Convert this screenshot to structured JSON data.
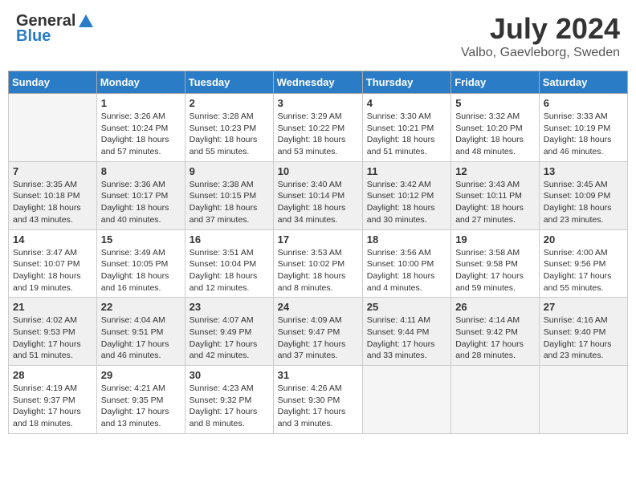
{
  "header": {
    "logo_general": "General",
    "logo_blue": "Blue",
    "month_year": "July 2024",
    "location": "Valbo, Gaevleborg, Sweden"
  },
  "days_of_week": [
    "Sunday",
    "Monday",
    "Tuesday",
    "Wednesday",
    "Thursday",
    "Friday",
    "Saturday"
  ],
  "weeks": [
    [
      {
        "day": "",
        "sunrise": "",
        "sunset": "",
        "daylight": "",
        "empty": true
      },
      {
        "day": "1",
        "sunrise": "Sunrise: 3:26 AM",
        "sunset": "Sunset: 10:24 PM",
        "daylight": "Daylight: 18 hours and 57 minutes."
      },
      {
        "day": "2",
        "sunrise": "Sunrise: 3:28 AM",
        "sunset": "Sunset: 10:23 PM",
        "daylight": "Daylight: 18 hours and 55 minutes."
      },
      {
        "day": "3",
        "sunrise": "Sunrise: 3:29 AM",
        "sunset": "Sunset: 10:22 PM",
        "daylight": "Daylight: 18 hours and 53 minutes."
      },
      {
        "day": "4",
        "sunrise": "Sunrise: 3:30 AM",
        "sunset": "Sunset: 10:21 PM",
        "daylight": "Daylight: 18 hours and 51 minutes."
      },
      {
        "day": "5",
        "sunrise": "Sunrise: 3:32 AM",
        "sunset": "Sunset: 10:20 PM",
        "daylight": "Daylight: 18 hours and 48 minutes."
      },
      {
        "day": "6",
        "sunrise": "Sunrise: 3:33 AM",
        "sunset": "Sunset: 10:19 PM",
        "daylight": "Daylight: 18 hours and 46 minutes."
      }
    ],
    [
      {
        "day": "7",
        "sunrise": "Sunrise: 3:35 AM",
        "sunset": "Sunset: 10:18 PM",
        "daylight": "Daylight: 18 hours and 43 minutes."
      },
      {
        "day": "8",
        "sunrise": "Sunrise: 3:36 AM",
        "sunset": "Sunset: 10:17 PM",
        "daylight": "Daylight: 18 hours and 40 minutes."
      },
      {
        "day": "9",
        "sunrise": "Sunrise: 3:38 AM",
        "sunset": "Sunset: 10:15 PM",
        "daylight": "Daylight: 18 hours and 37 minutes."
      },
      {
        "day": "10",
        "sunrise": "Sunrise: 3:40 AM",
        "sunset": "Sunset: 10:14 PM",
        "daylight": "Daylight: 18 hours and 34 minutes."
      },
      {
        "day": "11",
        "sunrise": "Sunrise: 3:42 AM",
        "sunset": "Sunset: 10:12 PM",
        "daylight": "Daylight: 18 hours and 30 minutes."
      },
      {
        "day": "12",
        "sunrise": "Sunrise: 3:43 AM",
        "sunset": "Sunset: 10:11 PM",
        "daylight": "Daylight: 18 hours and 27 minutes."
      },
      {
        "day": "13",
        "sunrise": "Sunrise: 3:45 AM",
        "sunset": "Sunset: 10:09 PM",
        "daylight": "Daylight: 18 hours and 23 minutes."
      }
    ],
    [
      {
        "day": "14",
        "sunrise": "Sunrise: 3:47 AM",
        "sunset": "Sunset: 10:07 PM",
        "daylight": "Daylight: 18 hours and 19 minutes."
      },
      {
        "day": "15",
        "sunrise": "Sunrise: 3:49 AM",
        "sunset": "Sunset: 10:05 PM",
        "daylight": "Daylight: 18 hours and 16 minutes."
      },
      {
        "day": "16",
        "sunrise": "Sunrise: 3:51 AM",
        "sunset": "Sunset: 10:04 PM",
        "daylight": "Daylight: 18 hours and 12 minutes."
      },
      {
        "day": "17",
        "sunrise": "Sunrise: 3:53 AM",
        "sunset": "Sunset: 10:02 PM",
        "daylight": "Daylight: 18 hours and 8 minutes."
      },
      {
        "day": "18",
        "sunrise": "Sunrise: 3:56 AM",
        "sunset": "Sunset: 10:00 PM",
        "daylight": "Daylight: 18 hours and 4 minutes."
      },
      {
        "day": "19",
        "sunrise": "Sunrise: 3:58 AM",
        "sunset": "Sunset: 9:58 PM",
        "daylight": "Daylight: 17 hours and 59 minutes."
      },
      {
        "day": "20",
        "sunrise": "Sunrise: 4:00 AM",
        "sunset": "Sunset: 9:56 PM",
        "daylight": "Daylight: 17 hours and 55 minutes."
      }
    ],
    [
      {
        "day": "21",
        "sunrise": "Sunrise: 4:02 AM",
        "sunset": "Sunset: 9:53 PM",
        "daylight": "Daylight: 17 hours and 51 minutes."
      },
      {
        "day": "22",
        "sunrise": "Sunrise: 4:04 AM",
        "sunset": "Sunset: 9:51 PM",
        "daylight": "Daylight: 17 hours and 46 minutes."
      },
      {
        "day": "23",
        "sunrise": "Sunrise: 4:07 AM",
        "sunset": "Sunset: 9:49 PM",
        "daylight": "Daylight: 17 hours and 42 minutes."
      },
      {
        "day": "24",
        "sunrise": "Sunrise: 4:09 AM",
        "sunset": "Sunset: 9:47 PM",
        "daylight": "Daylight: 17 hours and 37 minutes."
      },
      {
        "day": "25",
        "sunrise": "Sunrise: 4:11 AM",
        "sunset": "Sunset: 9:44 PM",
        "daylight": "Daylight: 17 hours and 33 minutes."
      },
      {
        "day": "26",
        "sunrise": "Sunrise: 4:14 AM",
        "sunset": "Sunset: 9:42 PM",
        "daylight": "Daylight: 17 hours and 28 minutes."
      },
      {
        "day": "27",
        "sunrise": "Sunrise: 4:16 AM",
        "sunset": "Sunset: 9:40 PM",
        "daylight": "Daylight: 17 hours and 23 minutes."
      }
    ],
    [
      {
        "day": "28",
        "sunrise": "Sunrise: 4:19 AM",
        "sunset": "Sunset: 9:37 PM",
        "daylight": "Daylight: 17 hours and 18 minutes."
      },
      {
        "day": "29",
        "sunrise": "Sunrise: 4:21 AM",
        "sunset": "Sunset: 9:35 PM",
        "daylight": "Daylight: 17 hours and 13 minutes."
      },
      {
        "day": "30",
        "sunrise": "Sunrise: 4:23 AM",
        "sunset": "Sunset: 9:32 PM",
        "daylight": "Daylight: 17 hours and 8 minutes."
      },
      {
        "day": "31",
        "sunrise": "Sunrise: 4:26 AM",
        "sunset": "Sunset: 9:30 PM",
        "daylight": "Daylight: 17 hours and 3 minutes."
      },
      {
        "day": "",
        "sunrise": "",
        "sunset": "",
        "daylight": "",
        "empty": true
      },
      {
        "day": "",
        "sunrise": "",
        "sunset": "",
        "daylight": "",
        "empty": true
      },
      {
        "day": "",
        "sunrise": "",
        "sunset": "",
        "daylight": "",
        "empty": true
      }
    ]
  ]
}
